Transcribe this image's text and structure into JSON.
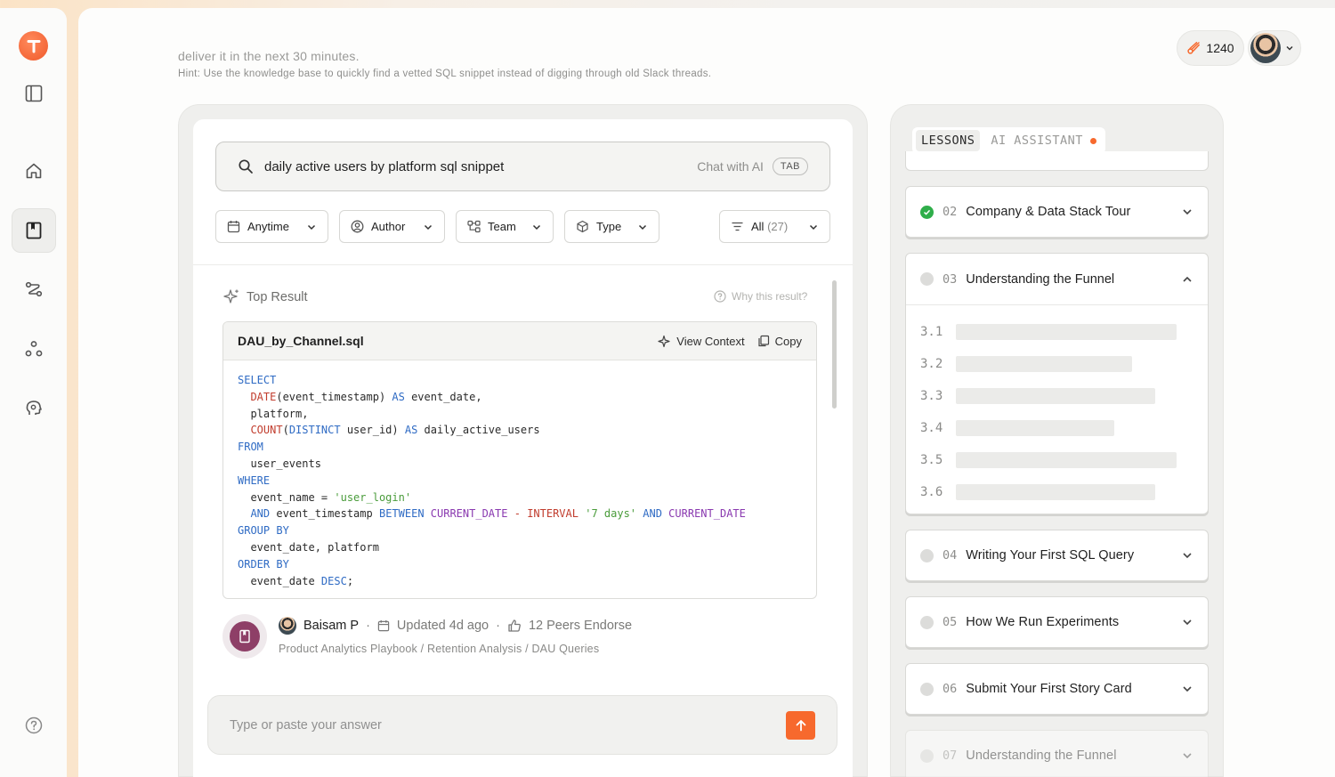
{
  "header": {
    "task_line": "deliver it in the next 30 minutes.",
    "hint": "Hint: Use the knowledge base to quickly find a vetted SQL snippet instead of digging through old Slack threads.",
    "points": "1240"
  },
  "sidebar": {
    "items": [
      {
        "icon": "sidebar-toggle-icon"
      },
      {
        "icon": "home-icon"
      },
      {
        "icon": "book-icon",
        "active": true
      },
      {
        "icon": "route-icon"
      },
      {
        "icon": "network-icon"
      },
      {
        "icon": "brain-icon"
      },
      {
        "icon": "help-icon"
      }
    ]
  },
  "search": {
    "query": "daily active users by platform sql snippet",
    "chat_label": "Chat with AI",
    "tab_key": "TAB"
  },
  "filters": {
    "anytime": "Anytime",
    "author": "Author",
    "team": "Team",
    "type": "Type",
    "all": "All",
    "all_count": "(27)"
  },
  "result": {
    "heading": "Top Result",
    "why": "Why this result?",
    "file_name": "DAU_by_Channel.sql",
    "view_context": "View Context",
    "copy": "Copy",
    "author": "Baisam P",
    "updated": "Updated 4d ago",
    "endorse": "12 Peers Endorse",
    "breadcrumb": "Product Analytics Playbook / Retention Analysis / DAU Queries"
  },
  "answer": {
    "placeholder": "Type or paste your answer"
  },
  "lessons_panel": {
    "tab_lessons": "LESSONS",
    "tab_ai": "AI ASSISTANT",
    "lessons": [
      {
        "num": "02",
        "title": "Company & Data Stack Tour",
        "status": "done"
      },
      {
        "num": "03",
        "title": "Understanding the Funnel",
        "status": "open"
      },
      {
        "num": "04",
        "title": "Writing Your First SQL Query",
        "status": "pending"
      },
      {
        "num": "05",
        "title": "How We Run Experiments",
        "status": "pending"
      },
      {
        "num": "06",
        "title": "Submit Your First Story Card",
        "status": "pending"
      },
      {
        "num": "07",
        "title": "Understanding the Funnel",
        "status": "locked"
      }
    ],
    "sub_items": [
      "3.1",
      "3.2",
      "3.3",
      "3.4",
      "3.5",
      "3.6"
    ]
  },
  "colors": {
    "accent": "#f7692d",
    "done": "#2fae4a",
    "keyword": "#2f6bc4",
    "function": "#c13d2e",
    "string": "#4a9c3b"
  }
}
